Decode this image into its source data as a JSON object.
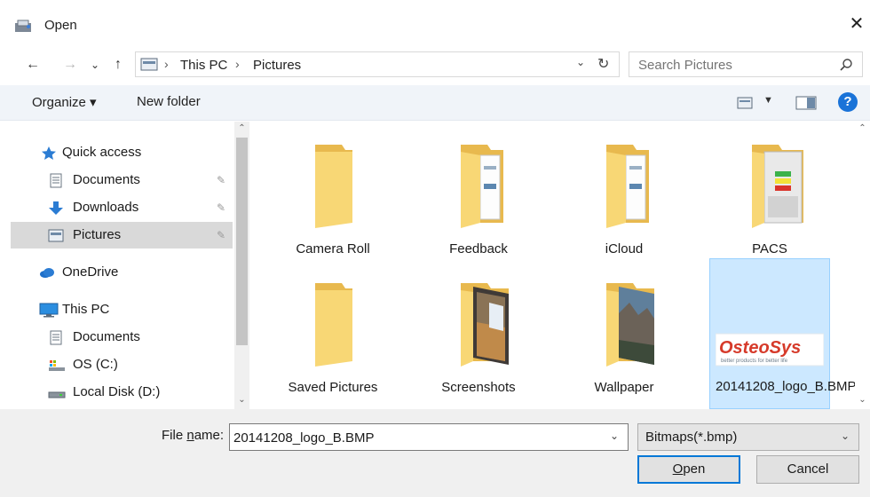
{
  "window": {
    "title": "Open",
    "close_glyph": "✕"
  },
  "address_bar": {
    "back_glyph": "←",
    "forward_glyph": "→",
    "recent_glyph": "⌄",
    "up_glyph": "↑",
    "sep_glyph": "›",
    "crumbs": [
      "This PC",
      "Pictures"
    ],
    "dropdown_glyph": "⌄",
    "refresh_glyph": "↻"
  },
  "search": {
    "placeholder": "Search Pictures"
  },
  "commands": {
    "organize": "Organize ▾",
    "new_folder": "New folder",
    "view_dropdown_glyph": "▼",
    "help_glyph": "?"
  },
  "nav": {
    "pin_glyph": "✎",
    "items": [
      {
        "label": "Quick access",
        "icon": "star-icon"
      },
      {
        "label": "Documents",
        "icon": "document-icon",
        "pinned": true
      },
      {
        "label": "Downloads",
        "icon": "download-icon",
        "pinned": true
      },
      {
        "label": "Pictures",
        "icon": "pictures-icon",
        "pinned": true,
        "selected": true
      },
      {
        "label": "OneDrive",
        "icon": "cloud-icon"
      },
      {
        "label": "This PC",
        "icon": "computer-icon"
      },
      {
        "label": "Documents",
        "icon": "document-icon"
      },
      {
        "label": "OS (C:)",
        "icon": "drive-icon"
      },
      {
        "label": "Local Disk (D:)",
        "icon": "disk-icon"
      }
    ],
    "scroll_up_glyph": "⌃",
    "scroll_down_glyph": "⌄"
  },
  "files": {
    "items": [
      {
        "name": "Camera Roll",
        "thumb": "folder-icon"
      },
      {
        "name": "Feedback",
        "thumb": "folder-docs-icon"
      },
      {
        "name": "iCloud",
        "thumb": "folder-docs-icon"
      },
      {
        "name": "PACS",
        "thumb": "folder-app-icon"
      },
      {
        "name": "Saved Pictures",
        "thumb": "folder-icon"
      },
      {
        "name": "Screenshots",
        "thumb": "folder-photo-icon"
      },
      {
        "name": "Wallpaper",
        "thumb": "folder-landscape-icon"
      },
      {
        "name": "20141208_logo_B.BMP",
        "thumb": "bitmap-logo-thumbnail",
        "selected": true
      }
    ],
    "logo_text": "OsteoSys",
    "logo_tagline": "better products for better life"
  },
  "footer": {
    "file_name_label_pre": "File ",
    "file_name_label_ul": "n",
    "file_name_label_post": "ame:",
    "file_name_value": "20141208_logo_B.BMP",
    "filter_value": "Bitmaps(*.bmp)",
    "dropdown_glyph": "⌄",
    "open_ul": "O",
    "open_rest": "pen",
    "cancel_label": "Cancel"
  },
  "colors": {
    "accent": "#0078d7",
    "selection": "#cce8ff",
    "folder": "#f8d775",
    "help": "#1a73d8"
  }
}
